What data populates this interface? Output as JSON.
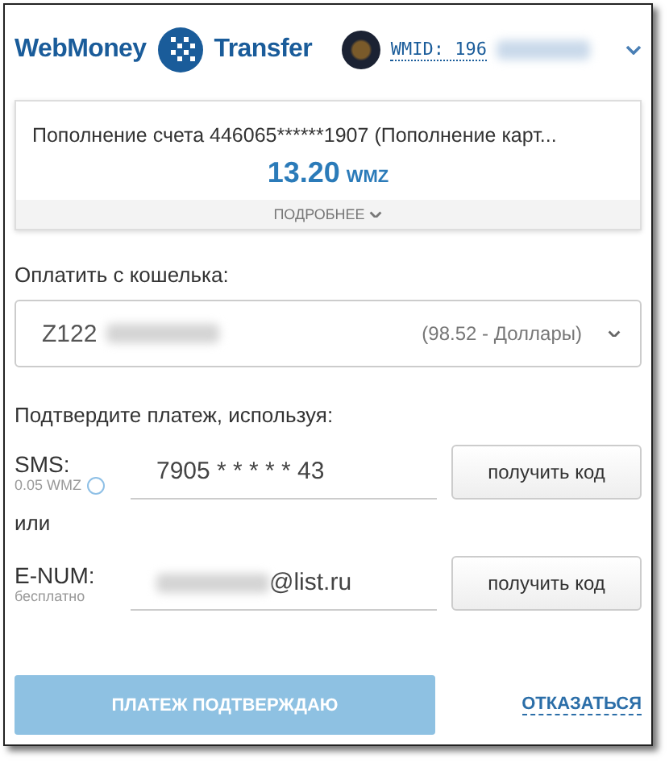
{
  "header": {
    "brand_left": "WebMoney",
    "brand_right": "Transfer",
    "wmid": "WMID: 196"
  },
  "payment": {
    "description": "Пополнение счета 446065******1907 (Пополнение карт...",
    "amount": "13.20",
    "currency": "WMZ",
    "details_link": "ПОДРОБНЕЕ"
  },
  "wallet": {
    "label": "Оплатить с кошелька:",
    "value": "Z122",
    "balance": "(98.52 - Доллары)"
  },
  "confirm": {
    "label": "Подтвердите платеж, используя:",
    "separator": "или",
    "methods": [
      {
        "name": "SMS:",
        "note": "0.05 WMZ",
        "help": true,
        "value": "7905 * * * * * 43",
        "button": "получить код"
      },
      {
        "name": "E-NUM:",
        "note": "бесплатно",
        "help": false,
        "value": "@list.ru",
        "button": "получить код"
      }
    ]
  },
  "actions": {
    "submit": {
      "label": "ПЛАТЕЖ ПОДТВЕРЖДАЮ",
      "disabled": true
    },
    "cancel": "ОТКАЗАТЬСЯ"
  }
}
